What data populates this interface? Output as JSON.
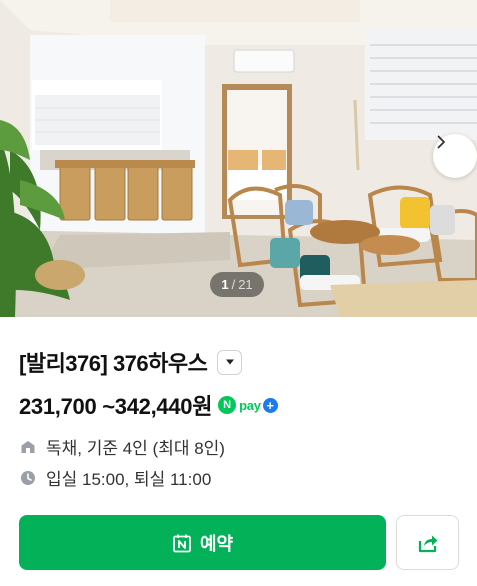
{
  "gallery": {
    "current": "1",
    "separator": "/",
    "total": "21",
    "next_icon": "chevron-right-icon"
  },
  "listing": {
    "title": "[발리376] 376하우스",
    "dropdown_icon": "caret-down-icon",
    "price": "231,700 ~342,440원",
    "npay": {
      "badge": "N",
      "text": "pay",
      "plus": "+"
    },
    "type_line": "독채, 기준 4인 (최대 8인)",
    "type_icon": "house-icon",
    "time_line": "입실 15:00, 퇴실 11:00",
    "time_icon": "clock-icon"
  },
  "actions": {
    "book_label": "예약",
    "book_icon": "calendar-n-icon",
    "share_icon": "share-icon"
  },
  "colors": {
    "accent_green": "#03b158",
    "npay_green": "#03c75a",
    "npay_blue": "#1a7cf0"
  }
}
